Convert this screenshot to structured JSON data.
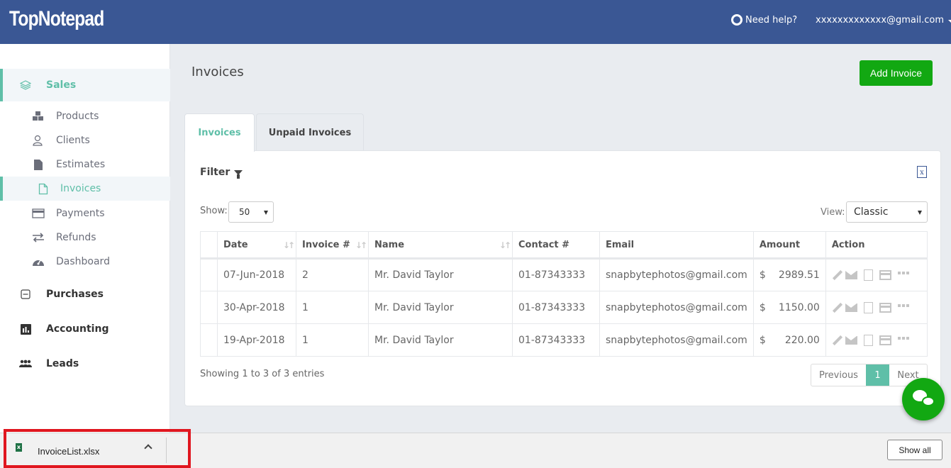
{
  "header": {
    "logo": "TopNotepad",
    "help_label": "Need help?",
    "user_email": "xxxxxxxxxxxxx@gmail.com"
  },
  "sidebar": {
    "groups": [
      {
        "label": "Sales",
        "icon": "layers-icon",
        "active": true
      },
      {
        "label": "Purchases",
        "icon": "minus-square-icon"
      },
      {
        "label": "Accounting",
        "icon": "bar-chart-icon"
      },
      {
        "label": "Leads",
        "icon": "users-icon"
      }
    ],
    "sales_items": [
      {
        "label": "Products",
        "icon": "cubes-icon"
      },
      {
        "label": "Clients",
        "icon": "user-outline-icon"
      },
      {
        "label": "Estimates",
        "icon": "file-icon"
      },
      {
        "label": "Invoices",
        "icon": "file-outline-icon",
        "active": true
      },
      {
        "label": "Payments",
        "icon": "credit-card-icon"
      },
      {
        "label": "Refunds",
        "icon": "exchange-icon"
      },
      {
        "label": "Dashboard",
        "icon": "dashboard-icon"
      }
    ]
  },
  "main": {
    "title": "Invoices",
    "add_button": "Add Invoice",
    "tabs": [
      {
        "label": "Invoices",
        "active": true
      },
      {
        "label": "Unpaid Invoices"
      }
    ],
    "filter_label": "Filter",
    "show_label": "Show:",
    "show_value": "50",
    "view_label": "View:",
    "view_value": "Classic",
    "table": {
      "columns": [
        "",
        "Date",
        "Invoice #",
        "Name",
        "Contact #",
        "Email",
        "Amount",
        "Action"
      ],
      "rows": [
        {
          "date": "07-Jun-2018",
          "invoice": "2",
          "name": "Mr. David Taylor",
          "contact": "01-87343333",
          "email": "snapbytephotos@gmail.com",
          "currency": "$",
          "amount": "2989.51"
        },
        {
          "date": "30-Apr-2018",
          "invoice": "1",
          "name": "Mr. David Taylor",
          "contact": "01-87343333",
          "email": "snapbytephotos@gmail.com",
          "currency": "$",
          "amount": "1150.00"
        },
        {
          "date": "19-Apr-2018",
          "invoice": "1",
          "name": "Mr. David Taylor",
          "contact": "01-87343333",
          "email": "snapbytephotos@gmail.com",
          "currency": "$",
          "amount": "220.00"
        }
      ]
    },
    "entries_info": "Showing 1 to 3 of 3 entries",
    "pagination": {
      "previous": "Previous",
      "current": "1",
      "next": "Next"
    }
  },
  "download_bar": {
    "file_name": "InvoiceList.xlsx",
    "show_all": "Show all"
  },
  "colors": {
    "header_bg": "#3a5794",
    "accent": "#5fbfa8",
    "add_button": "#12a812",
    "highlight_border": "#e0161f"
  }
}
